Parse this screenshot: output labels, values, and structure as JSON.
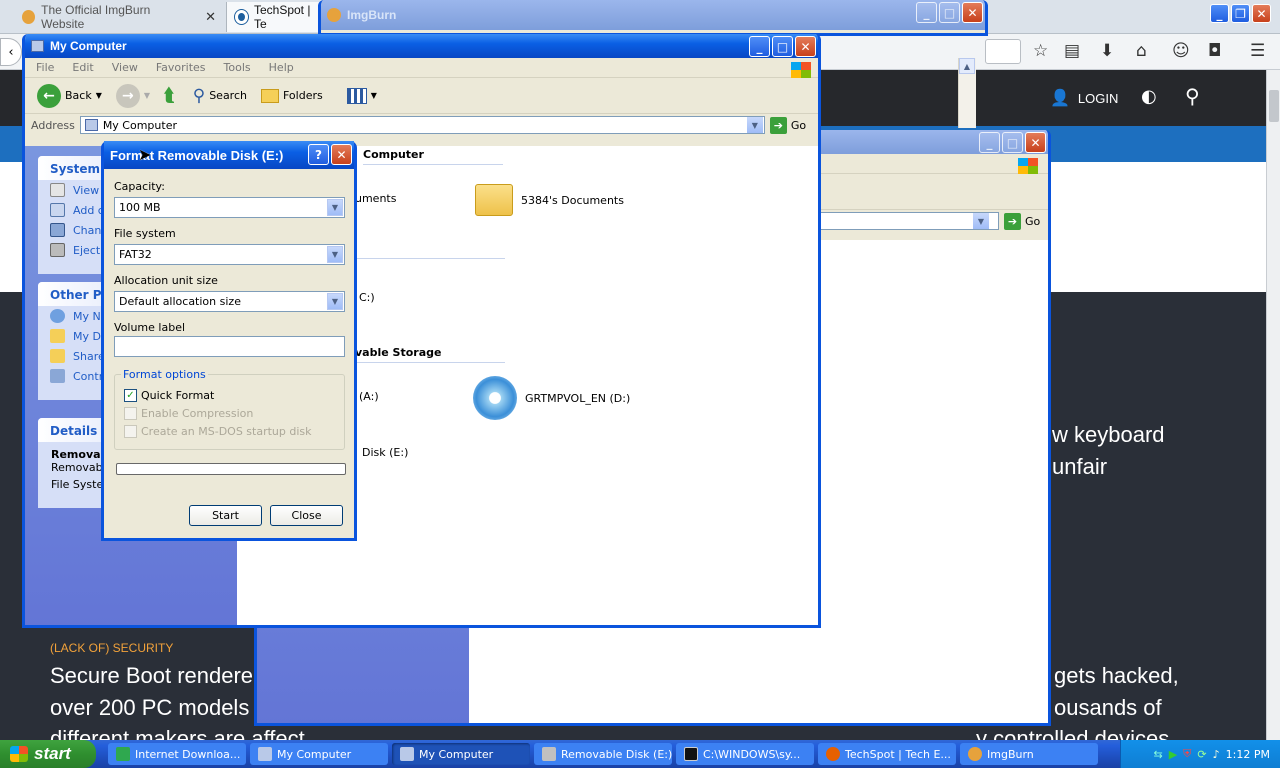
{
  "firefox": {
    "tabs": [
      {
        "label": "The Official ImgBurn Website"
      },
      {
        "label": "TechSpot | Te"
      }
    ],
    "toolbar_icons": [
      "star-icon",
      "reading-list-icon",
      "download-icon",
      "home-icon",
      "smiley-icon",
      "pocket-icon",
      "hamburger-menu-icon"
    ],
    "login_label": "LOGIN"
  },
  "techspot": {
    "headline_right_1": "w keyboard",
    "headline_right_2": "unfair",
    "section_label": "(LACK OF) SECURITY",
    "story_line_1": "Secure Boot rendere",
    "story_line_2": "over 200 PC models t",
    "story_line_3": "different makers are affect",
    "story_right_1": "gets hacked,",
    "story_right_2": "ousands of",
    "story_right_3": "y controlled devices"
  },
  "imgburn": {
    "title": "ImgBurn"
  },
  "mycomputer_back": {
    "title": ""
  },
  "mycomputer": {
    "title": "My Computer",
    "menu": [
      "File",
      "Edit",
      "View",
      "Favorites",
      "Tools",
      "Help"
    ],
    "toolbar": {
      "back": "Back",
      "search": "Search",
      "folders": "Folders"
    },
    "address_label": "Address",
    "address_value": "My Computer",
    "go_label": "Go",
    "tasks": {
      "system_head": "System",
      "system_items": [
        "View",
        "Add c",
        "Chang",
        "Eject"
      ],
      "other_head": "Other Pla",
      "other_items": [
        "My Ne",
        "My Do",
        "Share",
        "Contr"
      ],
      "details_head": "Details",
      "details_name": "Remova",
      "details_type": "Removab",
      "details_fs": "File Syste"
    },
    "sections": {
      "files_stored": "Computer",
      "hdd": "",
      "removable": "vable Storage"
    },
    "items": {
      "shared_docs": "uments",
      "user_docs": "5384's Documents",
      "local_disk": "C:)",
      "floppy": "(A:)",
      "cd": "GRTMPVOL_EN (D:)",
      "removable": "Disk (E:)"
    }
  },
  "format_dialog": {
    "title": "Format Removable Disk (E:)",
    "capacity_label": "Capacity:",
    "capacity_value": "100 MB",
    "fs_label": "File system",
    "fs_value": "FAT32",
    "alloc_label": "Allocation unit size",
    "alloc_value": "Default allocation size",
    "volume_label": "Volume label",
    "volume_value": "",
    "options_label": "Format options",
    "quick_format": "Quick Format",
    "quick_format_checked": true,
    "compression": "Enable Compression",
    "msdos": "Create an MS-DOS startup disk",
    "progress": 0,
    "start_label": "Start",
    "close_label": "Close"
  },
  "taskbar": {
    "start_label": "start",
    "items": [
      {
        "label": "Internet Downloa..."
      },
      {
        "label": "My Computer"
      },
      {
        "label": "My Computer"
      },
      {
        "label": "Removable Disk (E:)"
      },
      {
        "label": "C:\\WINDOWS\\sy..."
      },
      {
        "label": "TechSpot | Tech E..."
      },
      {
        "label": "ImgBurn"
      }
    ],
    "clock": "1:12 PM"
  },
  "colors": {
    "xp_blue": "#0a54dd",
    "techspot_blue": "#1d6fbf",
    "taskbar_green": "#3fa33f"
  }
}
